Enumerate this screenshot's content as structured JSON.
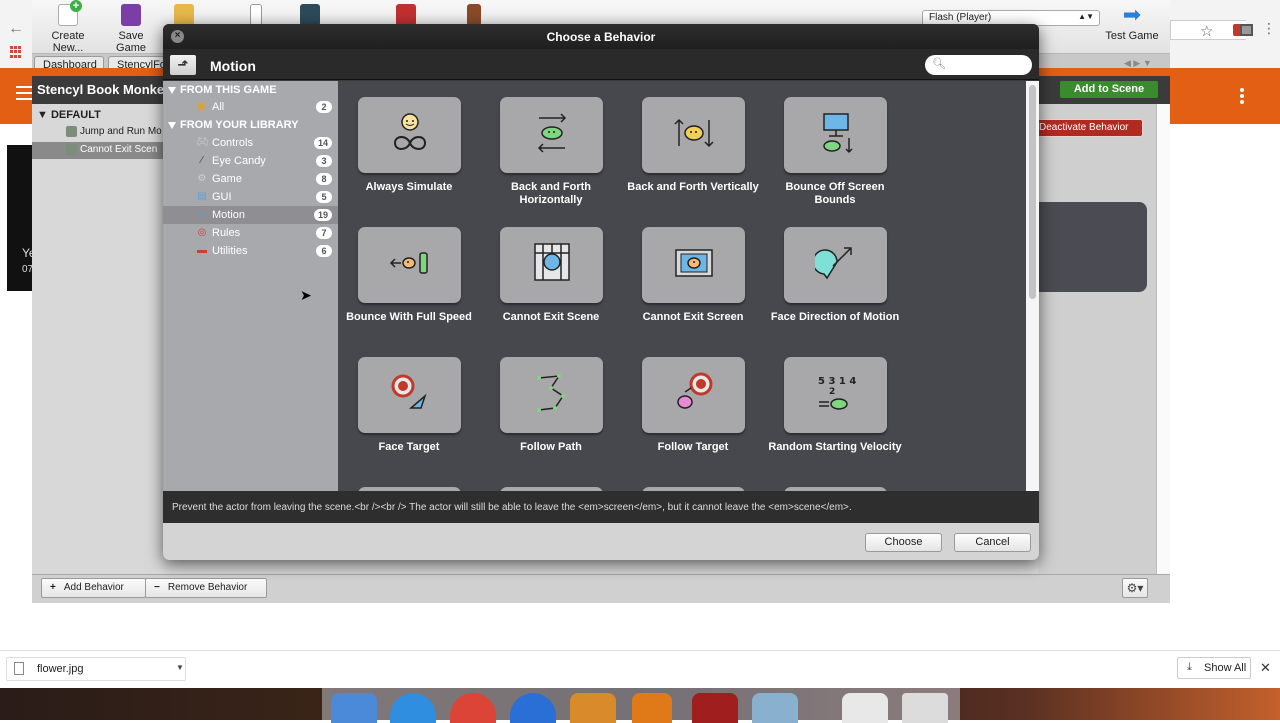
{
  "browser": {
    "apps_label": "A",
    "ext_hint": "s"
  },
  "stencyl": {
    "toolbar": {
      "create_label": "Create New...",
      "save_label": "Save Game",
      "test_label": "Test Game",
      "flash_select": "Flash (Player)"
    },
    "tabs": [
      {
        "label": "Dashboard"
      },
      {
        "label": "StencylFor"
      }
    ],
    "scene_title": "Stencyl Book Monke",
    "add_to_scene": "Add to Scene",
    "default_label": "DEFAULT",
    "list": [
      {
        "label": "Jump and Run Mo"
      },
      {
        "label": "Cannot Exit Scen"
      }
    ],
    "deactivate_label": "Deactivate Behavior",
    "preview_text_a": "Ye",
    "preview_text_b": "07",
    "add_behavior": "Add Behavior",
    "remove_behavior": "Remove Behavior"
  },
  "downloads": {
    "file": "flower.jpg",
    "show_all": "Show All",
    "close_glyph": "✕"
  },
  "dialog": {
    "title": "Choose a Behavior",
    "header_title": "Motion",
    "search": {
      "value": "",
      "placeholder": ""
    },
    "sidebar": {
      "section_game": "FROM THIS GAME",
      "section_library": "FROM YOUR LIBRARY",
      "items": [
        {
          "label": "All",
          "count": "2",
          "icon": "folder-icon",
          "color": "#e0a030"
        },
        {
          "label": "Controls",
          "count": "14",
          "icon": "gamepad-icon",
          "color": "#cfcfcf"
        },
        {
          "label": "Eye Candy",
          "count": "3",
          "icon": "wand-icon",
          "color": "#444444"
        },
        {
          "label": "Game",
          "count": "8",
          "icon": "gears-icon",
          "color": "#d0d0d0"
        },
        {
          "label": "GUI",
          "count": "5",
          "icon": "window-icon",
          "color": "#5aa0d8"
        },
        {
          "label": "Motion",
          "count": "19",
          "icon": "motion-icon",
          "color": "#5aa0d8"
        },
        {
          "label": "Rules",
          "count": "7",
          "icon": "target-icon",
          "color": "#d03a3a"
        },
        {
          "label": "Utilities",
          "count": "6",
          "icon": "toolbox-icon",
          "color": "#d03a3a"
        }
      ]
    },
    "behaviors": [
      {
        "label": "Always Simulate",
        "icon": "infinity-face-icon"
      },
      {
        "label": "Back and Forth Horizontally",
        "icon": "horizontal-arrows-icon"
      },
      {
        "label": "Back and Forth Vertically",
        "icon": "vertical-arrows-icon"
      },
      {
        "label": "Bounce Off Screen Bounds",
        "icon": "screen-bounce-icon"
      },
      {
        "label": "Bounce With Full Speed",
        "icon": "speed-bounce-icon"
      },
      {
        "label": "Cannot Exit Scene",
        "icon": "caged-face-icon"
      },
      {
        "label": "Cannot Exit Screen",
        "icon": "framed-face-icon"
      },
      {
        "label": "Face Direction of Motion",
        "icon": "direction-arrow-icon"
      },
      {
        "label": "Face Target",
        "icon": "face-target-icon"
      },
      {
        "label": "Follow Path",
        "icon": "path-icon"
      },
      {
        "label": "Follow Target",
        "icon": "follow-target-icon"
      },
      {
        "label": "Random Starting Velocity",
        "icon": "random-velocity-icon"
      }
    ],
    "description": "Prevent the actor from leaving the scene.<br /><br /> The actor will still be able to leave the <em>screen</em>, but it cannot leave the <em>scene</em>.",
    "choose_label": "Choose",
    "cancel_label": "Cancel"
  }
}
